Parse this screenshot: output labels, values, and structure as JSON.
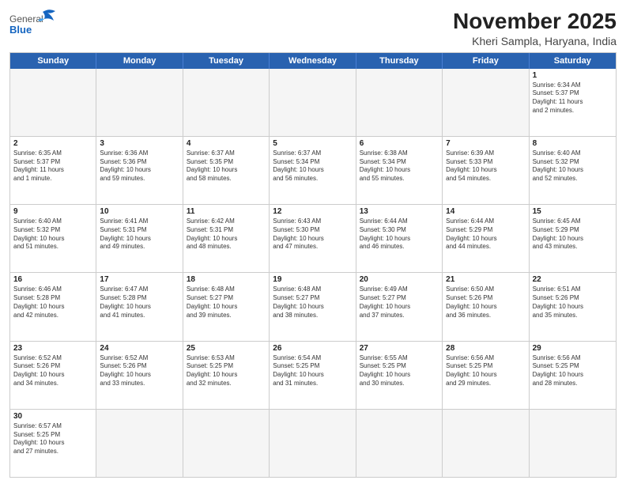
{
  "header": {
    "logo_general": "General",
    "logo_blue": "Blue",
    "title": "November 2025",
    "subtitle": "Kheri Sampla, Haryana, India"
  },
  "days_of_week": [
    "Sunday",
    "Monday",
    "Tuesday",
    "Wednesday",
    "Thursday",
    "Friday",
    "Saturday"
  ],
  "rows": [
    [
      {
        "day": "",
        "empty": true,
        "info": ""
      },
      {
        "day": "",
        "empty": true,
        "info": ""
      },
      {
        "day": "",
        "empty": true,
        "info": ""
      },
      {
        "day": "",
        "empty": true,
        "info": ""
      },
      {
        "day": "",
        "empty": true,
        "info": ""
      },
      {
        "day": "",
        "empty": true,
        "info": ""
      },
      {
        "day": "1",
        "empty": false,
        "info": "Sunrise: 6:34 AM\nSunset: 5:37 PM\nDaylight: 11 hours\nand 2 minutes."
      }
    ],
    [
      {
        "day": "2",
        "empty": false,
        "info": "Sunrise: 6:35 AM\nSunset: 5:37 PM\nDaylight: 11 hours\nand 1 minute."
      },
      {
        "day": "3",
        "empty": false,
        "info": "Sunrise: 6:36 AM\nSunset: 5:36 PM\nDaylight: 10 hours\nand 59 minutes."
      },
      {
        "day": "4",
        "empty": false,
        "info": "Sunrise: 6:37 AM\nSunset: 5:35 PM\nDaylight: 10 hours\nand 58 minutes."
      },
      {
        "day": "5",
        "empty": false,
        "info": "Sunrise: 6:37 AM\nSunset: 5:34 PM\nDaylight: 10 hours\nand 56 minutes."
      },
      {
        "day": "6",
        "empty": false,
        "info": "Sunrise: 6:38 AM\nSunset: 5:34 PM\nDaylight: 10 hours\nand 55 minutes."
      },
      {
        "day": "7",
        "empty": false,
        "info": "Sunrise: 6:39 AM\nSunset: 5:33 PM\nDaylight: 10 hours\nand 54 minutes."
      },
      {
        "day": "8",
        "empty": false,
        "info": "Sunrise: 6:40 AM\nSunset: 5:32 PM\nDaylight: 10 hours\nand 52 minutes."
      }
    ],
    [
      {
        "day": "9",
        "empty": false,
        "info": "Sunrise: 6:40 AM\nSunset: 5:32 PM\nDaylight: 10 hours\nand 51 minutes."
      },
      {
        "day": "10",
        "empty": false,
        "info": "Sunrise: 6:41 AM\nSunset: 5:31 PM\nDaylight: 10 hours\nand 49 minutes."
      },
      {
        "day": "11",
        "empty": false,
        "info": "Sunrise: 6:42 AM\nSunset: 5:31 PM\nDaylight: 10 hours\nand 48 minutes."
      },
      {
        "day": "12",
        "empty": false,
        "info": "Sunrise: 6:43 AM\nSunset: 5:30 PM\nDaylight: 10 hours\nand 47 minutes."
      },
      {
        "day": "13",
        "empty": false,
        "info": "Sunrise: 6:44 AM\nSunset: 5:30 PM\nDaylight: 10 hours\nand 46 minutes."
      },
      {
        "day": "14",
        "empty": false,
        "info": "Sunrise: 6:44 AM\nSunset: 5:29 PM\nDaylight: 10 hours\nand 44 minutes."
      },
      {
        "day": "15",
        "empty": false,
        "info": "Sunrise: 6:45 AM\nSunset: 5:29 PM\nDaylight: 10 hours\nand 43 minutes."
      }
    ],
    [
      {
        "day": "16",
        "empty": false,
        "info": "Sunrise: 6:46 AM\nSunset: 5:28 PM\nDaylight: 10 hours\nand 42 minutes."
      },
      {
        "day": "17",
        "empty": false,
        "info": "Sunrise: 6:47 AM\nSunset: 5:28 PM\nDaylight: 10 hours\nand 41 minutes."
      },
      {
        "day": "18",
        "empty": false,
        "info": "Sunrise: 6:48 AM\nSunset: 5:27 PM\nDaylight: 10 hours\nand 39 minutes."
      },
      {
        "day": "19",
        "empty": false,
        "info": "Sunrise: 6:48 AM\nSunset: 5:27 PM\nDaylight: 10 hours\nand 38 minutes."
      },
      {
        "day": "20",
        "empty": false,
        "info": "Sunrise: 6:49 AM\nSunset: 5:27 PM\nDaylight: 10 hours\nand 37 minutes."
      },
      {
        "day": "21",
        "empty": false,
        "info": "Sunrise: 6:50 AM\nSunset: 5:26 PM\nDaylight: 10 hours\nand 36 minutes."
      },
      {
        "day": "22",
        "empty": false,
        "info": "Sunrise: 6:51 AM\nSunset: 5:26 PM\nDaylight: 10 hours\nand 35 minutes."
      }
    ],
    [
      {
        "day": "23",
        "empty": false,
        "info": "Sunrise: 6:52 AM\nSunset: 5:26 PM\nDaylight: 10 hours\nand 34 minutes."
      },
      {
        "day": "24",
        "empty": false,
        "info": "Sunrise: 6:52 AM\nSunset: 5:26 PM\nDaylight: 10 hours\nand 33 minutes."
      },
      {
        "day": "25",
        "empty": false,
        "info": "Sunrise: 6:53 AM\nSunset: 5:25 PM\nDaylight: 10 hours\nand 32 minutes."
      },
      {
        "day": "26",
        "empty": false,
        "info": "Sunrise: 6:54 AM\nSunset: 5:25 PM\nDaylight: 10 hours\nand 31 minutes."
      },
      {
        "day": "27",
        "empty": false,
        "info": "Sunrise: 6:55 AM\nSunset: 5:25 PM\nDaylight: 10 hours\nand 30 minutes."
      },
      {
        "day": "28",
        "empty": false,
        "info": "Sunrise: 6:56 AM\nSunset: 5:25 PM\nDaylight: 10 hours\nand 29 minutes."
      },
      {
        "day": "29",
        "empty": false,
        "info": "Sunrise: 6:56 AM\nSunset: 5:25 PM\nDaylight: 10 hours\nand 28 minutes."
      }
    ],
    [
      {
        "day": "30",
        "empty": false,
        "info": "Sunrise: 6:57 AM\nSunset: 5:25 PM\nDaylight: 10 hours\nand 27 minutes."
      },
      {
        "day": "",
        "empty": true,
        "info": ""
      },
      {
        "day": "",
        "empty": true,
        "info": ""
      },
      {
        "day": "",
        "empty": true,
        "info": ""
      },
      {
        "day": "",
        "empty": true,
        "info": ""
      },
      {
        "day": "",
        "empty": true,
        "info": ""
      },
      {
        "day": "",
        "empty": true,
        "info": ""
      }
    ]
  ]
}
